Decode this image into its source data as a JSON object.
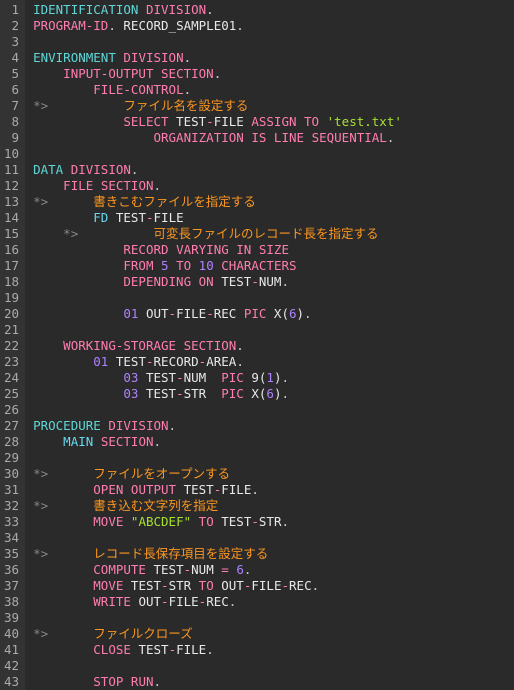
{
  "lines": [
    {
      "n": 1,
      "segs": [
        [
          "cyan",
          "IDENTIFICATION"
        ],
        [
          "white",
          " "
        ],
        [
          "kw",
          "DIVISION"
        ],
        [
          "pun",
          "."
        ]
      ]
    },
    {
      "n": 2,
      "segs": [
        [
          "kw",
          "PROGRAM-ID"
        ],
        [
          "pun",
          ". "
        ],
        [
          "white",
          "RECORD_SAMPLE01"
        ],
        [
          "pun",
          "."
        ]
      ]
    },
    {
      "n": 3,
      "segs": [
        [
          "white",
          ""
        ]
      ]
    },
    {
      "n": 4,
      "segs": [
        [
          "cyan",
          "ENVIRONMENT"
        ],
        [
          "white",
          " "
        ],
        [
          "kw",
          "DIVISION"
        ],
        [
          "pun",
          "."
        ]
      ]
    },
    {
      "n": 5,
      "segs": [
        [
          "white",
          "    "
        ],
        [
          "kw",
          "INPUT-OUTPUT"
        ],
        [
          "white",
          " "
        ],
        [
          "kw",
          "SECTION"
        ],
        [
          "pun",
          "."
        ]
      ]
    },
    {
      "n": 6,
      "segs": [
        [
          "white",
          "        "
        ],
        [
          "kw",
          "FILE-CONTROL"
        ],
        [
          "pun",
          "."
        ]
      ]
    },
    {
      "n": 7,
      "segs": [
        [
          "cmt",
          "*>"
        ],
        [
          "white",
          "          "
        ],
        [
          "org",
          "ファイル名を設定する"
        ]
      ]
    },
    {
      "n": 8,
      "segs": [
        [
          "white",
          "            "
        ],
        [
          "kw",
          "SELECT"
        ],
        [
          "white",
          " TEST"
        ],
        [
          "dash",
          "-"
        ],
        [
          "white",
          "FILE "
        ],
        [
          "kw",
          "ASSIGN"
        ],
        [
          "white",
          " "
        ],
        [
          "kw",
          "TO"
        ],
        [
          "white",
          " "
        ],
        [
          "str",
          "'test.txt'"
        ]
      ]
    },
    {
      "n": 9,
      "segs": [
        [
          "white",
          "                "
        ],
        [
          "kw",
          "ORGANIZATION"
        ],
        [
          "white",
          " "
        ],
        [
          "kw",
          "IS"
        ],
        [
          "white",
          " "
        ],
        [
          "kw",
          "LINE"
        ],
        [
          "white",
          " "
        ],
        [
          "kw",
          "SEQUENTIAL"
        ],
        [
          "pun",
          "."
        ]
      ]
    },
    {
      "n": 10,
      "segs": [
        [
          "white",
          ""
        ]
      ]
    },
    {
      "n": 11,
      "segs": [
        [
          "cyan",
          "DATA"
        ],
        [
          "white",
          " "
        ],
        [
          "kw",
          "DIVISION"
        ],
        [
          "pun",
          "."
        ]
      ]
    },
    {
      "n": 12,
      "segs": [
        [
          "white",
          "    "
        ],
        [
          "kw",
          "FILE"
        ],
        [
          "white",
          " "
        ],
        [
          "kw",
          "SECTION"
        ],
        [
          "pun",
          "."
        ]
      ]
    },
    {
      "n": 13,
      "segs": [
        [
          "cmt",
          "*>"
        ],
        [
          "white",
          "      "
        ],
        [
          "org",
          "書きこむファイルを指定する"
        ]
      ]
    },
    {
      "n": 14,
      "segs": [
        [
          "white",
          "        "
        ],
        [
          "blue",
          "FD"
        ],
        [
          "white",
          " TEST"
        ],
        [
          "dash",
          "-"
        ],
        [
          "white",
          "FILE"
        ]
      ]
    },
    {
      "n": 15,
      "segs": [
        [
          "white",
          "    "
        ],
        [
          "cmt",
          "*>"
        ],
        [
          "white",
          "          "
        ],
        [
          "org",
          "可変長ファイルのレコード長を指定する"
        ]
      ]
    },
    {
      "n": 16,
      "segs": [
        [
          "white",
          "            "
        ],
        [
          "kw",
          "RECORD"
        ],
        [
          "white",
          " "
        ],
        [
          "kw",
          "VARYING"
        ],
        [
          "white",
          " "
        ],
        [
          "kw",
          "IN"
        ],
        [
          "white",
          " "
        ],
        [
          "kw",
          "SIZE"
        ]
      ]
    },
    {
      "n": 17,
      "segs": [
        [
          "white",
          "            "
        ],
        [
          "kw",
          "FROM"
        ],
        [
          "white",
          " "
        ],
        [
          "num",
          "5"
        ],
        [
          "white",
          " "
        ],
        [
          "kw",
          "TO"
        ],
        [
          "white",
          " "
        ],
        [
          "num",
          "10"
        ],
        [
          "white",
          " "
        ],
        [
          "kw",
          "CHARACTERS"
        ]
      ]
    },
    {
      "n": 18,
      "segs": [
        [
          "white",
          "            "
        ],
        [
          "kw",
          "DEPENDING"
        ],
        [
          "white",
          " "
        ],
        [
          "kw",
          "ON"
        ],
        [
          "white",
          " TEST"
        ],
        [
          "dash",
          "-"
        ],
        [
          "white",
          "NUM"
        ],
        [
          "pun",
          "."
        ]
      ]
    },
    {
      "n": 19,
      "segs": [
        [
          "white",
          ""
        ]
      ]
    },
    {
      "n": 20,
      "segs": [
        [
          "white",
          "            "
        ],
        [
          "num",
          "01"
        ],
        [
          "white",
          " OUT"
        ],
        [
          "dash",
          "-"
        ],
        [
          "white",
          "FILE"
        ],
        [
          "dash",
          "-"
        ],
        [
          "white",
          "REC "
        ],
        [
          "kw",
          "PIC"
        ],
        [
          "white",
          " X("
        ],
        [
          "num",
          "6"
        ],
        [
          "white",
          ")"
        ],
        [
          "pun",
          "."
        ]
      ]
    },
    {
      "n": 21,
      "segs": [
        [
          "white",
          ""
        ]
      ]
    },
    {
      "n": 22,
      "segs": [
        [
          "white",
          "    "
        ],
        [
          "kw",
          "WORKING-STORAGE"
        ],
        [
          "white",
          " "
        ],
        [
          "kw",
          "SECTION"
        ],
        [
          "pun",
          "."
        ]
      ]
    },
    {
      "n": 23,
      "segs": [
        [
          "white",
          "        "
        ],
        [
          "num",
          "01"
        ],
        [
          "white",
          " TEST"
        ],
        [
          "dash",
          "-"
        ],
        [
          "white",
          "RECORD"
        ],
        [
          "dash",
          "-"
        ],
        [
          "white",
          "AREA"
        ],
        [
          "pun",
          "."
        ]
      ]
    },
    {
      "n": 24,
      "segs": [
        [
          "white",
          "            "
        ],
        [
          "num",
          "03"
        ],
        [
          "white",
          " TEST"
        ],
        [
          "dash",
          "-"
        ],
        [
          "white",
          "NUM  "
        ],
        [
          "kw",
          "PIC"
        ],
        [
          "white",
          " 9("
        ],
        [
          "num",
          "1"
        ],
        [
          "white",
          ")"
        ],
        [
          "pun",
          "."
        ]
      ]
    },
    {
      "n": 25,
      "segs": [
        [
          "white",
          "            "
        ],
        [
          "num",
          "03"
        ],
        [
          "white",
          " TEST"
        ],
        [
          "dash",
          "-"
        ],
        [
          "white",
          "STR  "
        ],
        [
          "kw",
          "PIC"
        ],
        [
          "white",
          " X("
        ],
        [
          "num",
          "6"
        ],
        [
          "white",
          ")"
        ],
        [
          "pun",
          "."
        ]
      ]
    },
    {
      "n": 26,
      "segs": [
        [
          "white",
          ""
        ]
      ]
    },
    {
      "n": 27,
      "segs": [
        [
          "cyan",
          "PROCEDURE"
        ],
        [
          "white",
          " "
        ],
        [
          "kw",
          "DIVISION"
        ],
        [
          "pun",
          "."
        ]
      ]
    },
    {
      "n": 28,
      "segs": [
        [
          "white",
          "    "
        ],
        [
          "blue",
          "MAIN"
        ],
        [
          "white",
          " "
        ],
        [
          "kw",
          "SECTION"
        ],
        [
          "pun",
          "."
        ]
      ]
    },
    {
      "n": 29,
      "segs": [
        [
          "white",
          ""
        ]
      ]
    },
    {
      "n": 30,
      "segs": [
        [
          "cmt",
          "*>"
        ],
        [
          "white",
          "      "
        ],
        [
          "org",
          "ファイルをオープンする"
        ]
      ]
    },
    {
      "n": 31,
      "segs": [
        [
          "white",
          "        "
        ],
        [
          "kw",
          "OPEN"
        ],
        [
          "white",
          " "
        ],
        [
          "kw",
          "OUTPUT"
        ],
        [
          "white",
          " TEST"
        ],
        [
          "dash",
          "-"
        ],
        [
          "white",
          "FILE"
        ],
        [
          "pun",
          "."
        ]
      ]
    },
    {
      "n": 32,
      "segs": [
        [
          "cmt",
          "*>"
        ],
        [
          "white",
          "      "
        ],
        [
          "org",
          "書き込む文字列を指定"
        ]
      ]
    },
    {
      "n": 33,
      "segs": [
        [
          "white",
          "        "
        ],
        [
          "kw",
          "MOVE"
        ],
        [
          "white",
          " "
        ],
        [
          "str",
          "\"ABCDEF\""
        ],
        [
          "white",
          " "
        ],
        [
          "kw",
          "TO"
        ],
        [
          "white",
          " TEST"
        ],
        [
          "dash",
          "-"
        ],
        [
          "white",
          "STR"
        ],
        [
          "pun",
          "."
        ]
      ]
    },
    {
      "n": 34,
      "segs": [
        [
          "white",
          ""
        ]
      ]
    },
    {
      "n": 35,
      "segs": [
        [
          "cmt",
          "*>"
        ],
        [
          "white",
          "      "
        ],
        [
          "org",
          "レコード長保存項目を設定する"
        ]
      ]
    },
    {
      "n": 36,
      "segs": [
        [
          "white",
          "        "
        ],
        [
          "kw",
          "COMPUTE"
        ],
        [
          "white",
          " TEST"
        ],
        [
          "dash",
          "-"
        ],
        [
          "white",
          "NUM "
        ],
        [
          "kw",
          "="
        ],
        [
          "white",
          " "
        ],
        [
          "num",
          "6"
        ],
        [
          "pun",
          "."
        ]
      ]
    },
    {
      "n": 37,
      "segs": [
        [
          "white",
          "        "
        ],
        [
          "kw",
          "MOVE"
        ],
        [
          "white",
          " TEST"
        ],
        [
          "dash",
          "-"
        ],
        [
          "white",
          "STR "
        ],
        [
          "kw",
          "TO"
        ],
        [
          "white",
          " OUT"
        ],
        [
          "dash",
          "-"
        ],
        [
          "white",
          "FILE"
        ],
        [
          "dash",
          "-"
        ],
        [
          "white",
          "REC"
        ],
        [
          "pun",
          "."
        ]
      ]
    },
    {
      "n": 38,
      "segs": [
        [
          "white",
          "        "
        ],
        [
          "kw",
          "WRITE"
        ],
        [
          "white",
          " OUT"
        ],
        [
          "dash",
          "-"
        ],
        [
          "white",
          "FILE"
        ],
        [
          "dash",
          "-"
        ],
        [
          "white",
          "REC"
        ],
        [
          "pun",
          "."
        ]
      ]
    },
    {
      "n": 39,
      "segs": [
        [
          "white",
          ""
        ]
      ]
    },
    {
      "n": 40,
      "segs": [
        [
          "cmt",
          "*>"
        ],
        [
          "white",
          "      "
        ],
        [
          "org",
          "ファイルクローズ"
        ]
      ]
    },
    {
      "n": 41,
      "segs": [
        [
          "white",
          "        "
        ],
        [
          "kw",
          "CLOSE"
        ],
        [
          "white",
          " TEST"
        ],
        [
          "dash",
          "-"
        ],
        [
          "white",
          "FILE"
        ],
        [
          "pun",
          "."
        ]
      ]
    },
    {
      "n": 42,
      "segs": [
        [
          "white",
          ""
        ]
      ]
    },
    {
      "n": 43,
      "segs": [
        [
          "white",
          "        "
        ],
        [
          "kw",
          "STOP"
        ],
        [
          "white",
          " "
        ],
        [
          "kw",
          "RUN"
        ],
        [
          "pun",
          "."
        ]
      ]
    }
  ]
}
